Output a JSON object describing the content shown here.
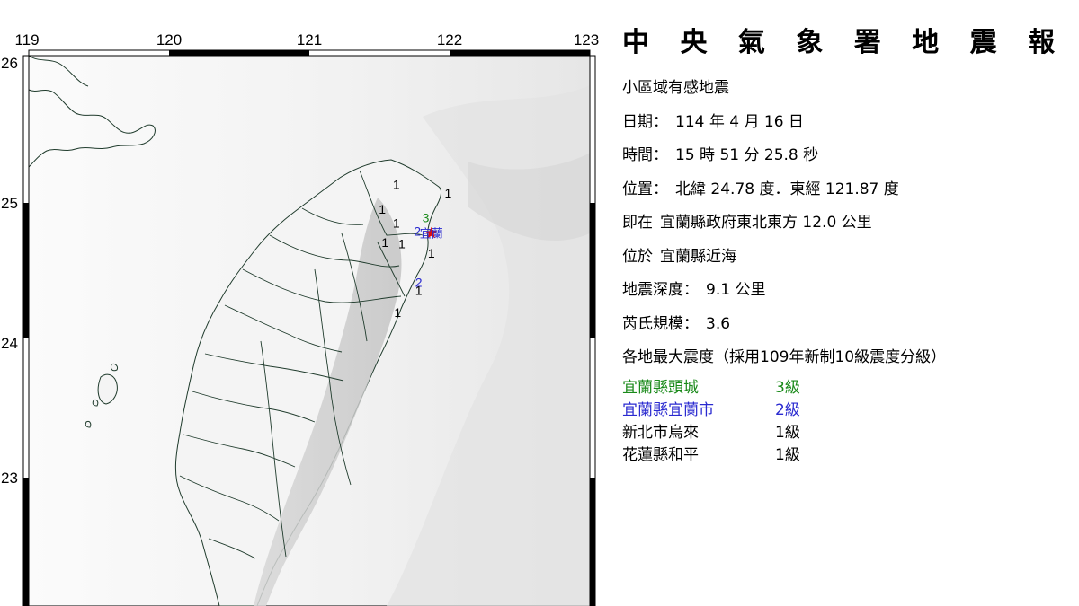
{
  "map": {
    "lon_ticks": [
      "119",
      "120",
      "121",
      "122",
      "123"
    ],
    "lat_ticks": [
      "26",
      "25",
      "24",
      "23"
    ],
    "epicenter_label": "宜蘭",
    "intensity_marks": [
      {
        "value": "3",
        "color": "#1a8a1a",
        "lon": 121.83,
        "lat": 24.86
      },
      {
        "value": "2",
        "color": "#2a2ad0",
        "lon": 121.77,
        "lat": 24.76
      },
      {
        "value": "2",
        "color": "#2a2ad0",
        "lon": 121.78,
        "lat": 24.39
      },
      {
        "value": "1",
        "color": "#000000",
        "lon": 121.99,
        "lat": 25.04
      },
      {
        "value": "1",
        "color": "#000000",
        "lon": 121.62,
        "lat": 25.1
      },
      {
        "value": "1",
        "color": "#000000",
        "lon": 121.52,
        "lat": 24.92
      },
      {
        "value": "1",
        "color": "#000000",
        "lon": 121.62,
        "lat": 24.82
      },
      {
        "value": "1",
        "color": "#000000",
        "lon": 121.54,
        "lat": 24.68
      },
      {
        "value": "1",
        "color": "#000000",
        "lon": 121.66,
        "lat": 24.67
      },
      {
        "value": "1",
        "color": "#000000",
        "lon": 121.87,
        "lat": 24.6
      },
      {
        "value": "1",
        "color": "#000000",
        "lon": 121.78,
        "lat": 24.33
      },
      {
        "value": "1",
        "color": "#000000",
        "lon": 121.63,
        "lat": 24.17
      }
    ],
    "epicenter": {
      "lon": 121.87,
      "lat": 24.78
    }
  },
  "report": {
    "title": "中 央 氣 象 署 地 震 報 告",
    "category": "小區域有感地震",
    "date_label": "日期：",
    "date_value": "114 年 4 月 16 日",
    "time_label": "時間：",
    "time_value": "15 時 51 分 25.8 秒",
    "position_label": "位置：",
    "position_value": "北緯 24.78 度．東經 121.87 度",
    "relative_label": "即在",
    "relative_value": "宜蘭縣政府東北東方 12.0 公里",
    "region_label": "位於",
    "region_value": "宜蘭縣近海",
    "depth_label": "地震深度：",
    "depth_value": "9.1 公里",
    "magnitude_label": "芮氏規模：",
    "magnitude_value": "3.6",
    "intensity_heading": "各地最大震度（採用109年新制10級震度分級）",
    "intensities": [
      {
        "location": "宜蘭縣頭城",
        "level": "3級",
        "color": "#1a8a1a"
      },
      {
        "location": "宜蘭縣宜蘭市",
        "level": "2級",
        "color": "#2a2ad0"
      },
      {
        "location": "新北市烏來",
        "level": "1級",
        "color": "#000000"
      },
      {
        "location": "花蓮縣和平",
        "level": "1級",
        "color": "#000000"
      }
    ]
  }
}
